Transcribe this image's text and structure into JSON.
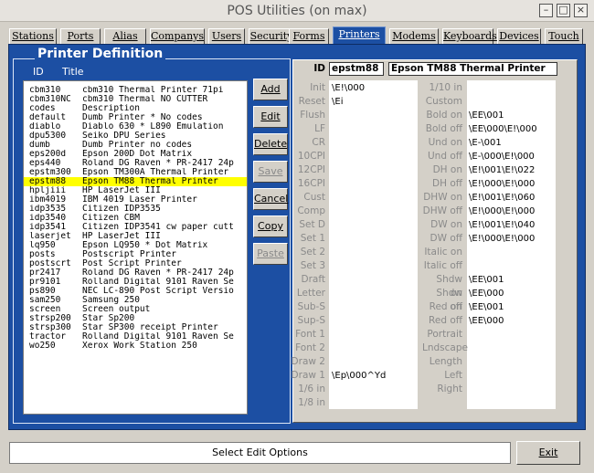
{
  "window": {
    "title": "POS Utilities (on max)",
    "minimize_glyph": "–",
    "maximize_glyph": "□",
    "close_glyph": "×"
  },
  "tabs": [
    {
      "label": "Stations"
    },
    {
      "label": "Ports"
    },
    {
      "label": "Alias"
    },
    {
      "label": "Companys"
    },
    {
      "label": "Users"
    },
    {
      "label": "Security"
    },
    {
      "label": "Forms"
    },
    {
      "label": "Printers",
      "active": true
    },
    {
      "label": "Modems"
    },
    {
      "label": "Keyboards"
    },
    {
      "label": "Devices"
    },
    {
      "label": "Touch"
    }
  ],
  "printer_definition": {
    "heading": "Printer Definition",
    "col_id": "ID",
    "col_title": "Title",
    "rows": [
      {
        "id": "cbm310",
        "title": "cbm310 Thermal Printer 71pi"
      },
      {
        "id": "cbm310NC",
        "title": "cbm310 Thermal NO CUTTER"
      },
      {
        "id": "codes",
        "title": "Description"
      },
      {
        "id": "default",
        "title": "Dumb Printer * No codes"
      },
      {
        "id": "diablo",
        "title": "Diablo 630 * L890 Emulation"
      },
      {
        "id": "dpu5300",
        "title": "Seiko DPU Series"
      },
      {
        "id": "dumb",
        "title": "Dumb Printer no codes"
      },
      {
        "id": "eps200d",
        "title": "Epson 200D Dot Matrix"
      },
      {
        "id": "eps440",
        "title": "Roland DG Raven * PR-2417 24p"
      },
      {
        "id": "epstm300",
        "title": "Epson TM300A Thermal Printer"
      },
      {
        "id": "epstm88",
        "title": "Epson TM88 Thermal Printer",
        "selected": true
      },
      {
        "id": "hpljiii",
        "title": "HP LaserJet III"
      },
      {
        "id": "ibm4019",
        "title": "IBM 4019 Laser Printer"
      },
      {
        "id": "idp3535",
        "title": "Citizen IDP3535"
      },
      {
        "id": "idp3540",
        "title": "Citizen CBM"
      },
      {
        "id": "idp3541",
        "title": "Citizen IDP3541 cw paper cutt"
      },
      {
        "id": "laserjet",
        "title": "HP LaserJet III"
      },
      {
        "id": "lq950",
        "title": "Epson LQ950 * Dot Matrix"
      },
      {
        "id": "posts",
        "title": "Postscript Printer"
      },
      {
        "id": "postscrt",
        "title": "Post Script Printer"
      },
      {
        "id": "pr2417",
        "title": "Roland DG Raven * PR-2417 24p"
      },
      {
        "id": "pr9101",
        "title": "Rolland Digital 9101 Raven Se"
      },
      {
        "id": "ps890",
        "title": "NEC LC-890 Post Script Versio"
      },
      {
        "id": "sam250",
        "title": "Samsung 250"
      },
      {
        "id": "screen",
        "title": "Screen output"
      },
      {
        "id": "strsp200",
        "title": "Star Sp200"
      },
      {
        "id": "strsp300",
        "title": "Star SP300 receipt Printer"
      },
      {
        "id": "tractor",
        "title": "Rolland Digital 9101 Raven Se"
      },
      {
        "id": "wo250",
        "title": "Xerox Work Station 250"
      }
    ]
  },
  "buttons": {
    "add": "Add",
    "edit": "Edit",
    "delete": "Delete",
    "save": "Save",
    "cancel": "Cancel",
    "copy": "Copy",
    "paste": "Paste"
  },
  "form": {
    "id_label": "ID",
    "id_value": "epstm88",
    "title_value": "Epson TM88 Thermal Printer",
    "left": [
      {
        "label": "Init",
        "value": "\\E!\\000"
      },
      {
        "label": "Reset",
        "value": "\\Ei"
      },
      {
        "label": "Flush",
        "value": ""
      },
      {
        "label": "LF",
        "value": ""
      },
      {
        "label": "CR",
        "value": ""
      },
      {
        "label": "10CPI",
        "value": ""
      },
      {
        "label": "12CPI",
        "value": ""
      },
      {
        "label": "16CPI",
        "value": ""
      },
      {
        "label": "Cust",
        "value": ""
      },
      {
        "label": "Comp",
        "value": ""
      },
      {
        "label": "Set D",
        "value": ""
      },
      {
        "label": "Set 1",
        "value": ""
      },
      {
        "label": "Set 2",
        "value": ""
      },
      {
        "label": "Set 3",
        "value": ""
      },
      {
        "label": "Draft",
        "value": ""
      },
      {
        "label": "Letter",
        "value": ""
      },
      {
        "label": "Sub-S",
        "value": ""
      },
      {
        "label": "Sup-S",
        "value": ""
      },
      {
        "label": "Font 1",
        "value": ""
      },
      {
        "label": "Font 2",
        "value": ""
      },
      {
        "label": "Draw 2",
        "value": ""
      },
      {
        "label": "Draw 1",
        "value": "\\Ep\\000^Yd"
      },
      {
        "label": "1/6 in",
        "value": ""
      },
      {
        "label": "1/8 in",
        "value": ""
      }
    ],
    "right": [
      {
        "label": "1/10 in",
        "value": ""
      },
      {
        "label": "Custom",
        "value": ""
      },
      {
        "label": "Bold on",
        "value": "\\EE\\001"
      },
      {
        "label": "Bold off",
        "value": "\\EE\\000\\E!\\000"
      },
      {
        "label": "Und on",
        "value": "\\E-\\001"
      },
      {
        "label": "Und off",
        "value": "\\E-\\000\\E!\\000"
      },
      {
        "label": "DH on",
        "value": "\\E!\\001\\E!\\022"
      },
      {
        "label": "DH off",
        "value": "\\E!\\000\\E!\\000"
      },
      {
        "label": "DHW on",
        "value": "\\E!\\001\\E!\\060"
      },
      {
        "label": "DHW off",
        "value": "\\E!\\000\\E!\\000"
      },
      {
        "label": "DW on",
        "value": "\\E!\\001\\E!\\040"
      },
      {
        "label": "DW off",
        "value": "\\E!\\000\\E!\\000"
      },
      {
        "label": "Italic on",
        "value": ""
      },
      {
        "label": "Italic off",
        "value": ""
      },
      {
        "label": "Shdw on",
        "value": "\\EE\\001"
      },
      {
        "label": "Shdw off",
        "value": "\\EE\\000"
      },
      {
        "label": "Red on",
        "value": "\\EE\\001"
      },
      {
        "label": "Red off",
        "value": "\\EE\\000"
      },
      {
        "label": "Portrait",
        "value": ""
      },
      {
        "label": "Lndscape",
        "value": ""
      },
      {
        "label": "Length",
        "value": ""
      },
      {
        "label": "Left",
        "value": ""
      },
      {
        "label": "Right",
        "value": ""
      }
    ]
  },
  "status": {
    "message": "Select Edit Options",
    "exit_label": "Exit"
  }
}
